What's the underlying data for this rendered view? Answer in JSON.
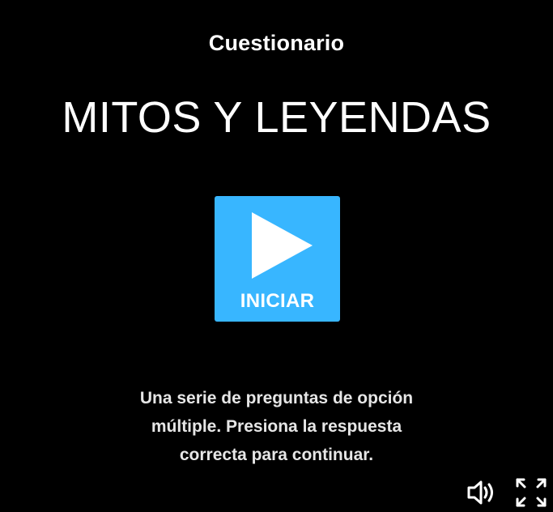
{
  "quiz": {
    "type_label": "Cuestionario",
    "title": "MITOS Y LEYENDAS",
    "start_label": "INICIAR",
    "description_lines": [
      "Una serie de preguntas de opción",
      "múltiple. Presiona la respuesta",
      "correcta para continuar."
    ]
  },
  "icons": {
    "play": "play-icon",
    "sound": "speaker-icon",
    "fullscreen": "fullscreen-icon"
  },
  "colors": {
    "background": "#000000",
    "accent": "#38b6ff",
    "text": "#ffffff",
    "description_text": "#e6e6e6"
  }
}
